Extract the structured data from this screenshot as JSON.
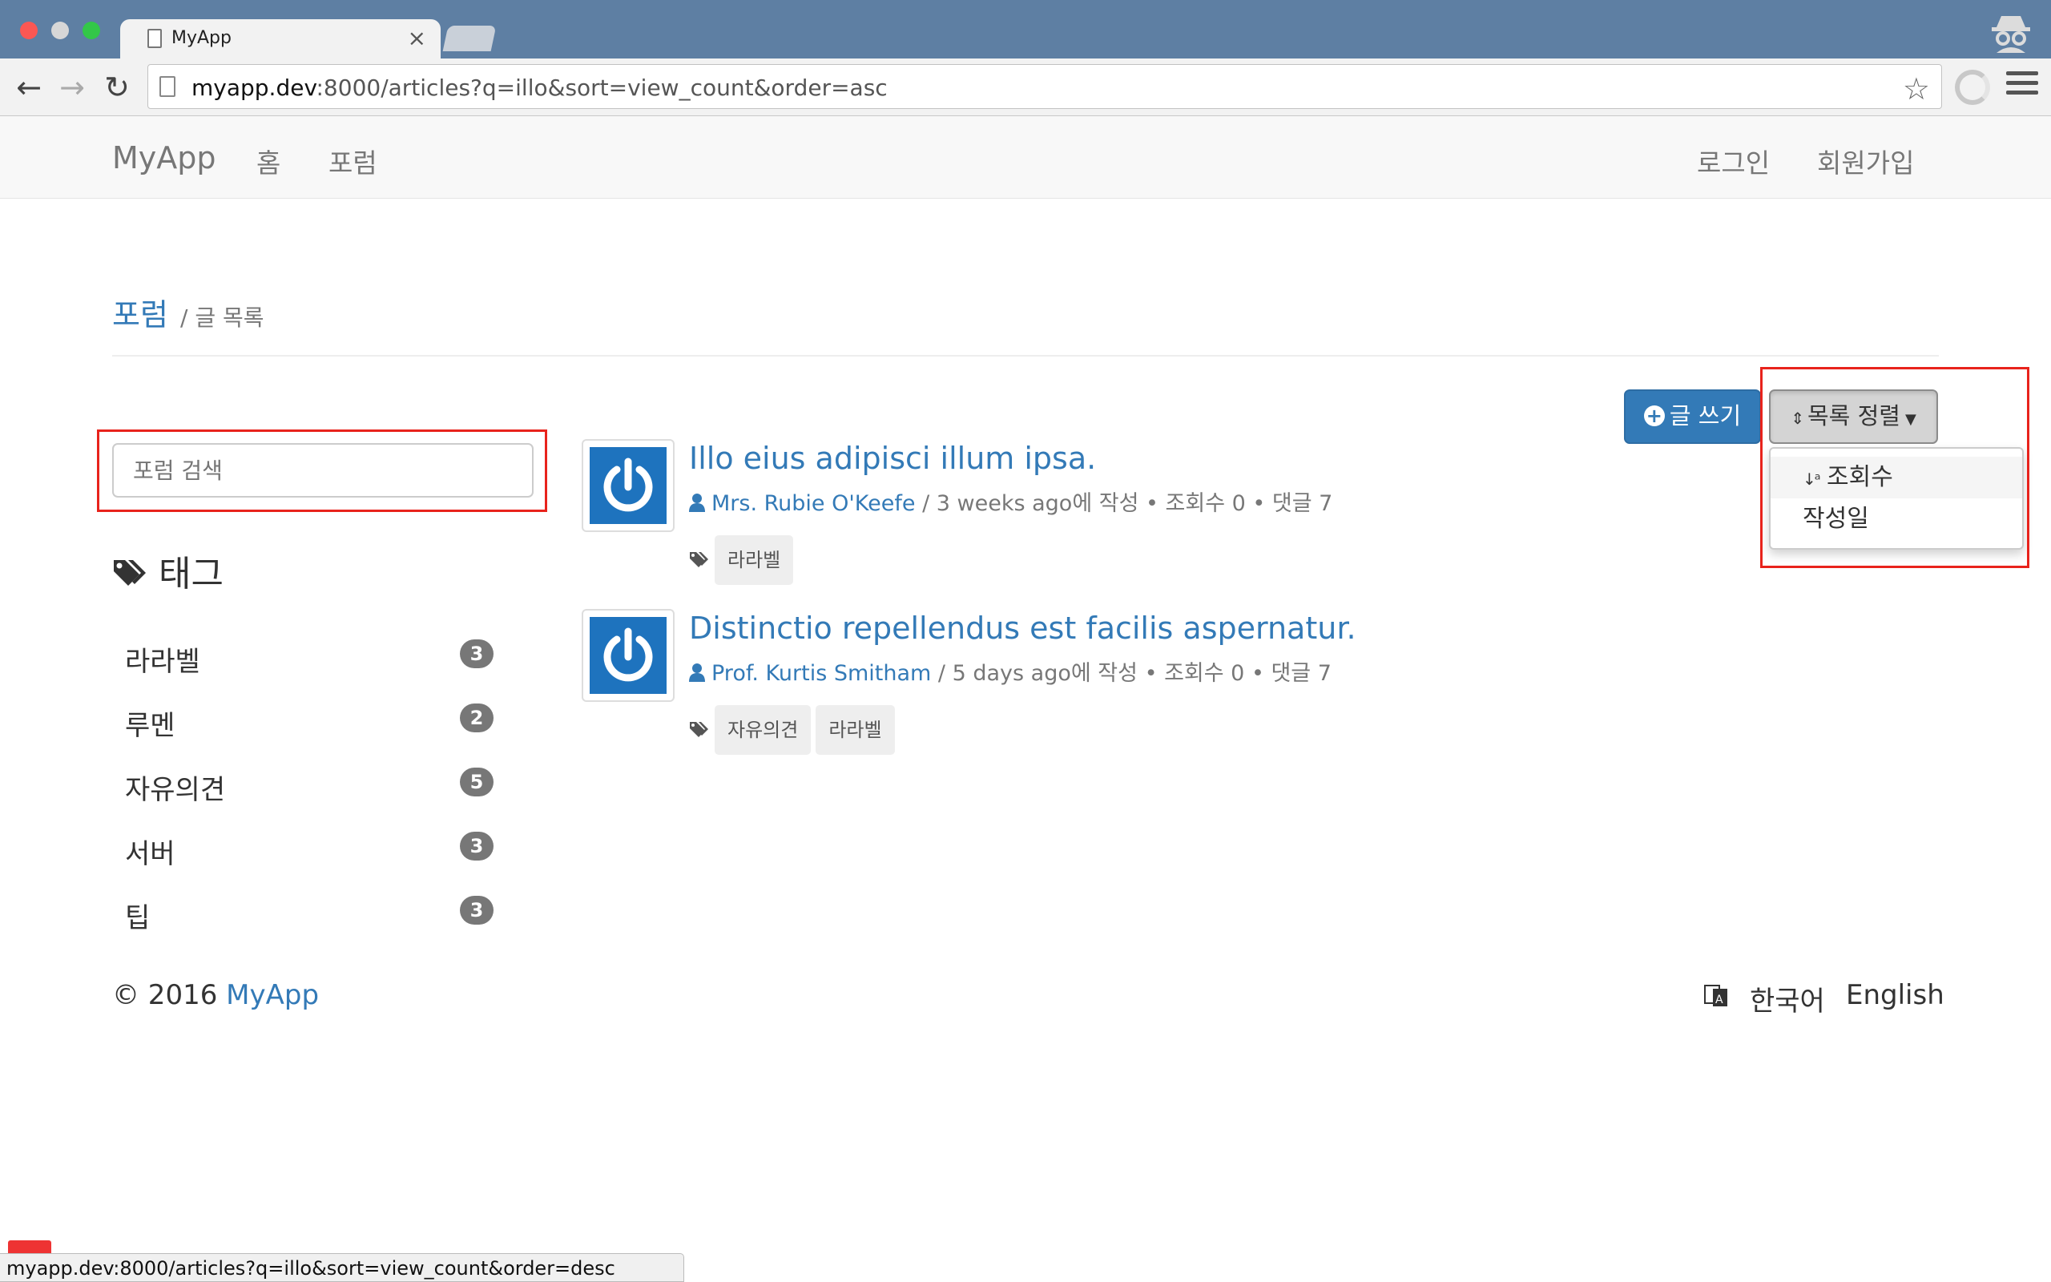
{
  "browser": {
    "tab_title": "MyApp",
    "tab_close": "×",
    "url_host": "myapp.dev",
    "url_rest": ":8000/articles?q=illo&sort=view_count&order=asc",
    "status_url": "myapp.dev:8000/articles?q=illo&sort=view_count&order=desc"
  },
  "navbar": {
    "brand": "MyApp",
    "home": "홈",
    "forum": "포럼",
    "login": "로그인",
    "signup": "회원가입"
  },
  "breadcrumb": {
    "link": "포럼",
    "current": "/ 글 목록"
  },
  "sidebar": {
    "search_placeholder": "포럼 검색",
    "tags_title": "태그",
    "tags": [
      {
        "name": "라라벨",
        "count": "3"
      },
      {
        "name": "루멘",
        "count": "2"
      },
      {
        "name": "자유의견",
        "count": "5"
      },
      {
        "name": "서버",
        "count": "3"
      },
      {
        "name": "팁",
        "count": "3"
      }
    ]
  },
  "actions": {
    "write_label": "글 쓰기",
    "sort_label": "목록 정렬",
    "sort_options": [
      "조회수",
      "작성일"
    ]
  },
  "articles": [
    {
      "title": "Illo eius adipisci illum ipsa.",
      "author": "Mrs. Rubie O'Keefe",
      "meta": " / 3 weeks ago에 작성  •  조회수 0  •  댓글 7",
      "tags": [
        "라라벨"
      ]
    },
    {
      "title": "Distinctio repellendus est facilis aspernatur.",
      "author": "Prof. Kurtis Smitham",
      "meta": " / 5 days ago에 작성  •  조회수 0  •  댓글 7",
      "tags": [
        "자유의견",
        "라라벨"
      ]
    }
  ],
  "footer": {
    "copyright": "© 2016 ",
    "brand": "MyApp",
    "lang_ko": "한국어",
    "lang_en": "English"
  },
  "colors": {
    "accent": "#337ab7",
    "highlight_box": "#e8231c",
    "badge": "#777777"
  }
}
